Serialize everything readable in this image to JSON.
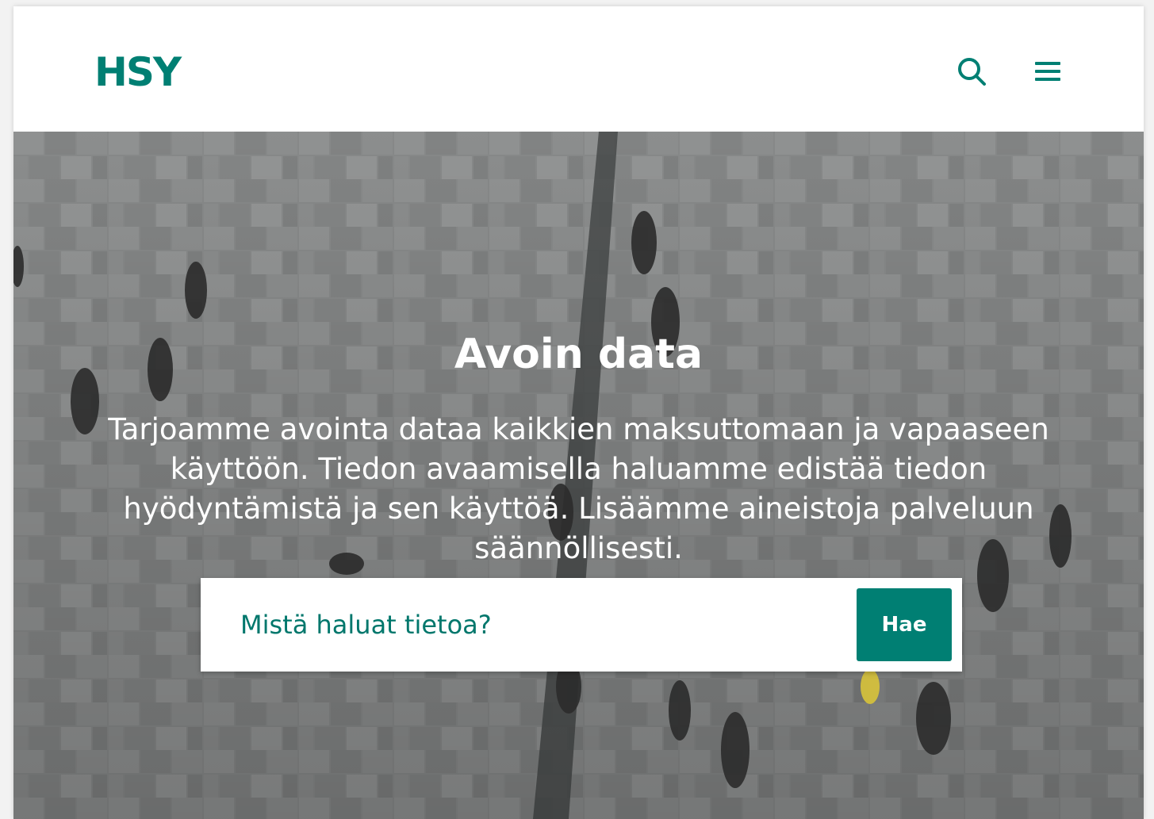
{
  "header": {
    "logo_text": "HSY",
    "search_icon": "search-icon",
    "menu_icon": "hamburger-menu-icon"
  },
  "hero": {
    "title": "Avoin data",
    "description": "Tarjoamme avointa dataa kaikkien maksuttomaan ja vapaaseen käyttöön. Tiedon avaamisella haluamme edistää tiedon hyödyntämistä ja sen käyttöä. Lisäämme aineistoja palveluun säännöllisesti.",
    "search": {
      "placeholder": "Mistä haluat tietoa?",
      "button_label": "Hae"
    }
  },
  "colors": {
    "brand": "#007f73",
    "hero_text": "#ffffff",
    "background": "#ffffff"
  }
}
